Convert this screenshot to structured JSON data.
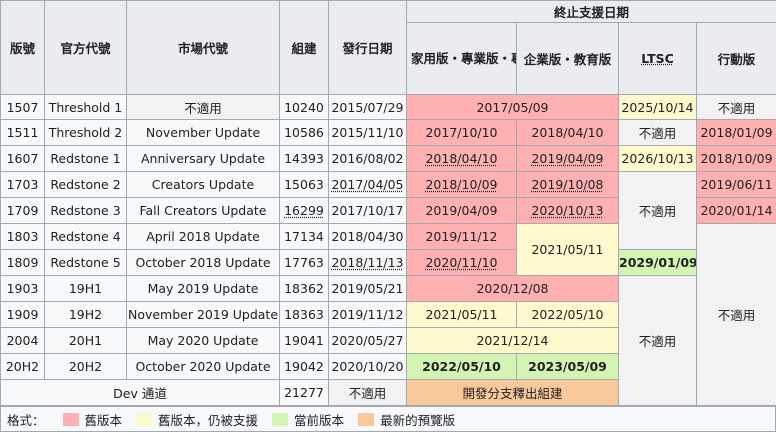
{
  "headers": {
    "version": "版號",
    "official": "官方代號",
    "market": "市場代號",
    "build": "組建",
    "release": "發行日期",
    "eos": "終止支援日期",
    "home_pro": "家用版・專業版・專業教育版・工作站專業版",
    "enterprise": "企業版・教育版",
    "ltsc": "LTSC",
    "mobile": "行動版"
  },
  "rows": [
    {
      "ver": "1507",
      "code": "Threshold 1",
      "market": "不適用",
      "build": "10240",
      "date": "2015/07/29",
      "home_ent": "2017/05/09",
      "ltsc": "2025/10/14",
      "mobile": "不適用"
    },
    {
      "ver": "1511",
      "code": "Threshold 2",
      "market": "November Update",
      "build": "10586",
      "date": "2015/11/10",
      "home": "2017/10/10",
      "ent": "2018/04/10",
      "ltsc": "不適用",
      "mobile": "2018/01/09"
    },
    {
      "ver": "1607",
      "code": "Redstone 1",
      "market": "Anniversary Update",
      "build": "14393",
      "date": "2016/08/02",
      "home": "2018/04/10",
      "ent": "2019/04/09",
      "ltsc": "2026/10/13",
      "mobile": "2018/10/09"
    },
    {
      "ver": "1703",
      "code": "Redstone 2",
      "market": "Creators Update",
      "build": "15063",
      "date": "2017/04/05",
      "home": "2018/10/09",
      "ent": "2019/10/08",
      "mobile": "2019/06/11"
    },
    {
      "ver": "1709",
      "code": "Redstone 3",
      "market": "Fall Creators Update",
      "build": "16299",
      "date": "2017/10/17",
      "home": "2019/04/09",
      "ent": "2020/10/13",
      "ltsc": "不適用",
      "mobile": "2020/01/14"
    },
    {
      "ver": "1803",
      "code": "Redstone 4",
      "market": "April 2018 Update",
      "build": "17134",
      "date": "2018/04/30",
      "home": "2019/11/12",
      "ent": "2021/05/11"
    },
    {
      "ver": "1809",
      "code": "Redstone 5",
      "market": "October 2018 Update",
      "build": "17763",
      "date": "2018/11/13",
      "home": "2020/11/10",
      "ltsc": "2029/01/09"
    },
    {
      "ver": "1903",
      "code": "19H1",
      "market": "May 2019 Update",
      "build": "18362",
      "date": "2019/05/21",
      "home_ent": "2020/12/08",
      "mobile": "不適用"
    },
    {
      "ver": "1909",
      "code": "19H2",
      "market": "November 2019 Update",
      "build": "18363",
      "date": "2019/11/12",
      "home": "2021/05/11",
      "ent": "2022/05/10",
      "ltsc": "不適用"
    },
    {
      "ver": "2004",
      "code": "20H1",
      "market": "May 2020 Update",
      "build": "19041",
      "date": "2020/05/27",
      "home_ent": "2021/12/14"
    },
    {
      "ver": "20H2",
      "code": "20H2",
      "market": "October 2020 Update",
      "build": "19042",
      "date": "2020/10/20",
      "home": "2022/05/10",
      "ent": "2023/05/09"
    }
  ],
  "dev": {
    "label": "Dev 通道",
    "build": "21277",
    "date": "不適用",
    "eos": "開發分支釋出組建"
  },
  "legend": {
    "label": "格式：",
    "items": [
      {
        "text": "舊版本",
        "color": "#ffb1b1"
      },
      {
        "text": "舊版本，仍被支援",
        "color": "#fffacd"
      },
      {
        "text": "當前版本",
        "color": "#d4f4b4"
      },
      {
        "text": "最新的預覽版",
        "color": "#f9c99b"
      }
    ]
  }
}
